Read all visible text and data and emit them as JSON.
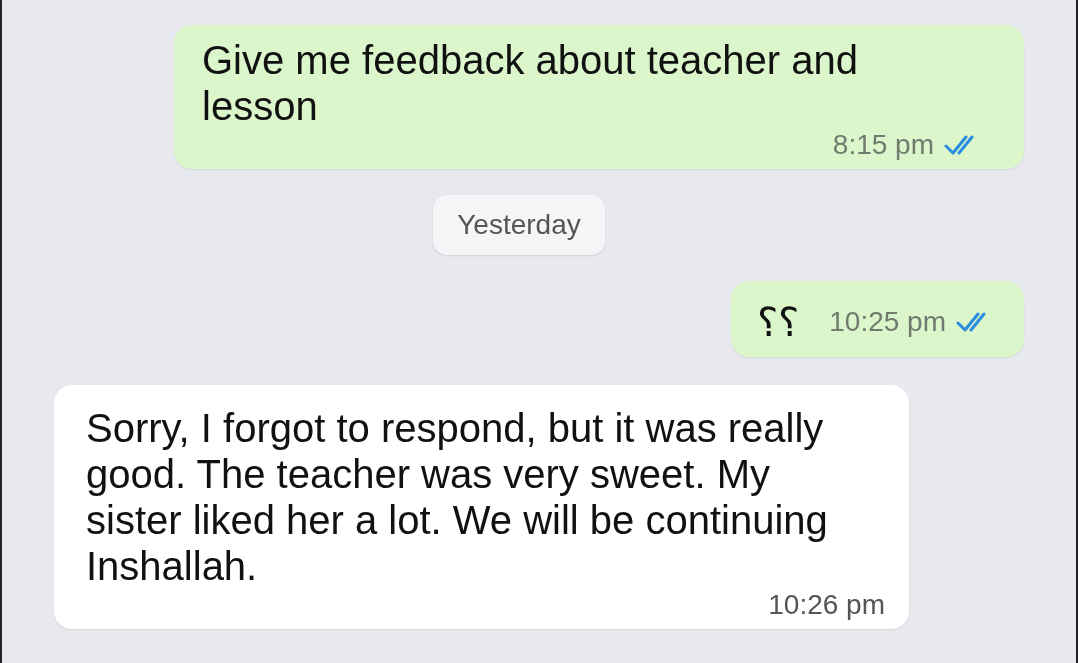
{
  "messages": [
    {
      "kind": "outgoing",
      "text": "Give me feedback about teacher and lesson",
      "time": "8:15 pm",
      "read": true
    },
    {
      "kind": "date",
      "text": "Yesterday"
    },
    {
      "kind": "outgoing",
      "text": "؟؟",
      "time": "10:25 pm",
      "read": true
    },
    {
      "kind": "incoming",
      "text": "Sorry, I forgot to respond, but it was really good. The teacher was very sweet. My sister liked her a lot. We will be continuing Inshallah.",
      "time": "10:26 pm"
    }
  ]
}
